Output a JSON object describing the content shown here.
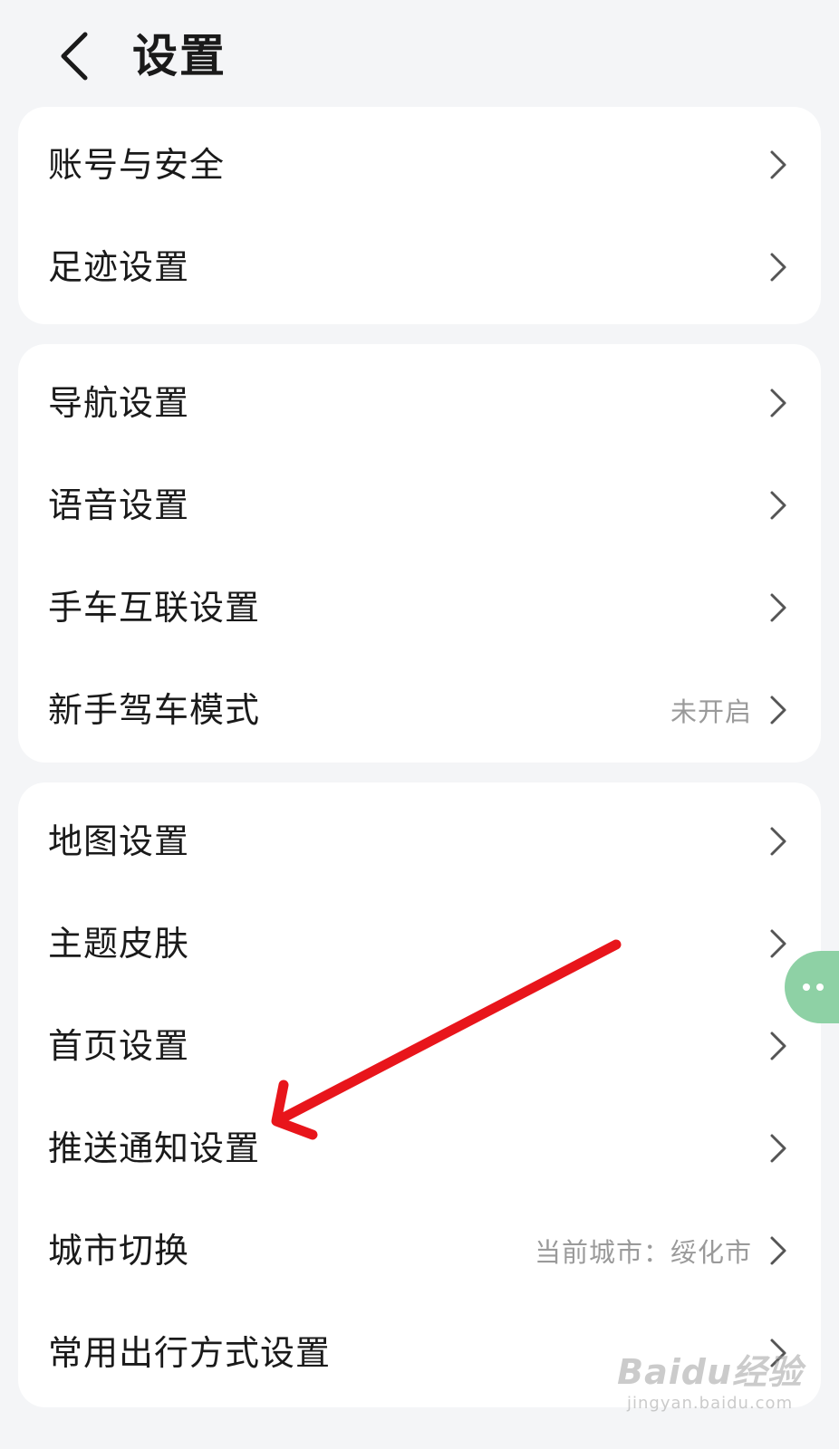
{
  "header": {
    "title": "设置",
    "back_icon": "chevron-left-icon"
  },
  "groups": [
    {
      "items": [
        {
          "label": "账号与安全",
          "value": ""
        },
        {
          "label": "足迹设置",
          "value": ""
        }
      ]
    },
    {
      "items": [
        {
          "label": "导航设置",
          "value": ""
        },
        {
          "label": "语音设置",
          "value": ""
        },
        {
          "label": "手车互联设置",
          "value": ""
        },
        {
          "label": "新手驾车模式",
          "value": "未开启"
        }
      ]
    },
    {
      "items": [
        {
          "label": "地图设置",
          "value": ""
        },
        {
          "label": "主题皮肤",
          "value": ""
        },
        {
          "label": "首页设置",
          "value": ""
        },
        {
          "label": "推送通知设置",
          "value": ""
        },
        {
          "label": "城市切换",
          "value": "当前城市：绥化市"
        },
        {
          "label": "常用出行方式设置",
          "value": ""
        }
      ]
    }
  ],
  "watermark": {
    "logo": "Baidu经验",
    "sub": "jingyan.baidu.com"
  },
  "colors": {
    "background": "#f4f5f7",
    "card": "#ffffff",
    "arrow": "#e8151b",
    "float_button": "#8ed1a5",
    "muted_text": "#9a9a9a"
  }
}
